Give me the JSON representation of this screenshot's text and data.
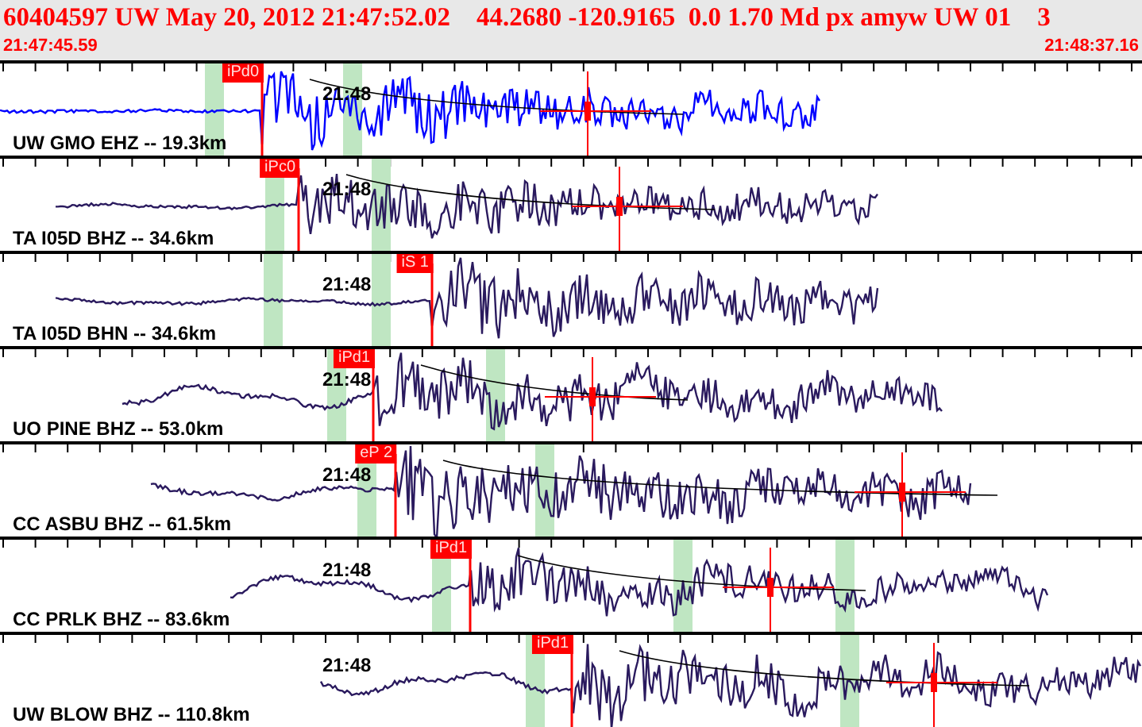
{
  "header": {
    "title": "60404597 UW May 20, 2012 21:47:52.02    44.2680 -120.9165  0.0 1.70 Md px amyw UW 01    3",
    "start_time": "21:47:45.59",
    "end_time": "21:48:37.16"
  },
  "traces": [
    {
      "station": "UW GMO EHZ -- 19.3km",
      "time_label": "21:48",
      "pick": "iPd0",
      "selected": true
    },
    {
      "station": "TA I05D BHZ -- 34.6km",
      "time_label": "21:48",
      "pick": "iPc0",
      "selected": false
    },
    {
      "station": "TA I05D BHN -- 34.6km",
      "time_label": "21:48",
      "pick": "iS 1",
      "selected": false
    },
    {
      "station": "UO PINE BHZ -- 53.0km",
      "time_label": "21:48",
      "pick": "iPd1",
      "selected": false
    },
    {
      "station": "CC ASBU BHZ -- 61.5km",
      "time_label": "21:48",
      "pick": "eP 2",
      "selected": false
    },
    {
      "station": "CC PRLK BHZ -- 83.6km",
      "time_label": "21:48",
      "pick": "iPd1",
      "selected": false
    },
    {
      "station": "UW BLOW BHZ -- 110.8km",
      "time_label": "21:48",
      "pick": "iPd1",
      "selected": false
    }
  ]
}
